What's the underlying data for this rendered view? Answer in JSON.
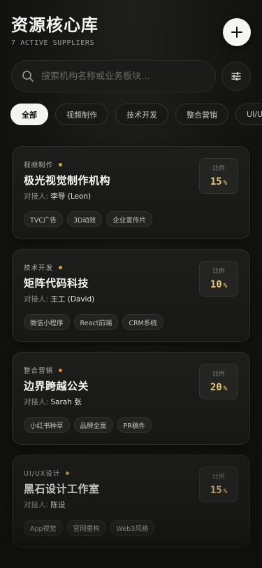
{
  "header": {
    "title": "资源核心库",
    "subtitle": "7 ACTIVE SUPPLIERS",
    "add_icon": "plus-icon"
  },
  "search": {
    "placeholder": "搜索机构名称或业务板块...",
    "value": "",
    "icon": "search-icon",
    "filter_icon": "sliders-icon"
  },
  "filters": [
    {
      "label": "全部",
      "active": true
    },
    {
      "label": "视频制作",
      "active": false
    },
    {
      "label": "技术开发",
      "active": false
    },
    {
      "label": "整合营销",
      "active": false
    },
    {
      "label": "UI/UX",
      "active": false
    }
  ],
  "ratio_label": "比例",
  "contact_label": "对接人:",
  "colors": {
    "accent": "#e3c676",
    "dot_gold": "#c8a54b",
    "dot_orange": "#e08840",
    "background": "#141412"
  },
  "suppliers": [
    {
      "category": "视频制作",
      "name": "极光视觉制作机构",
      "contact": "李导 (Leon)",
      "ratio": "15",
      "unit": "%",
      "dot_color": "#c8a54b",
      "tags": [
        "TVC广告",
        "3D动效",
        "企业宣传片"
      ]
    },
    {
      "category": "技术开发",
      "name": "矩阵代码科技",
      "contact": "王工 (David)",
      "ratio": "10",
      "unit": "%",
      "dot_color": "#c8a54b",
      "tags": [
        "微信小程序",
        "React前端",
        "CRM系统"
      ]
    },
    {
      "category": "整合营销",
      "name": "边界跨越公关",
      "contact": "Sarah 张",
      "ratio": "20",
      "unit": "%",
      "dot_color": "#e08840",
      "tags": [
        "小红书种草",
        "品牌全案",
        "PR稿件"
      ]
    },
    {
      "category": "UI/UX设计",
      "name": "黑石设计工作室",
      "contact": "陈设",
      "ratio": "15",
      "unit": "%",
      "dot_color": "#c8a54b",
      "tags": [
        "App视觉",
        "官网重构",
        "Web3风格"
      ]
    }
  ]
}
